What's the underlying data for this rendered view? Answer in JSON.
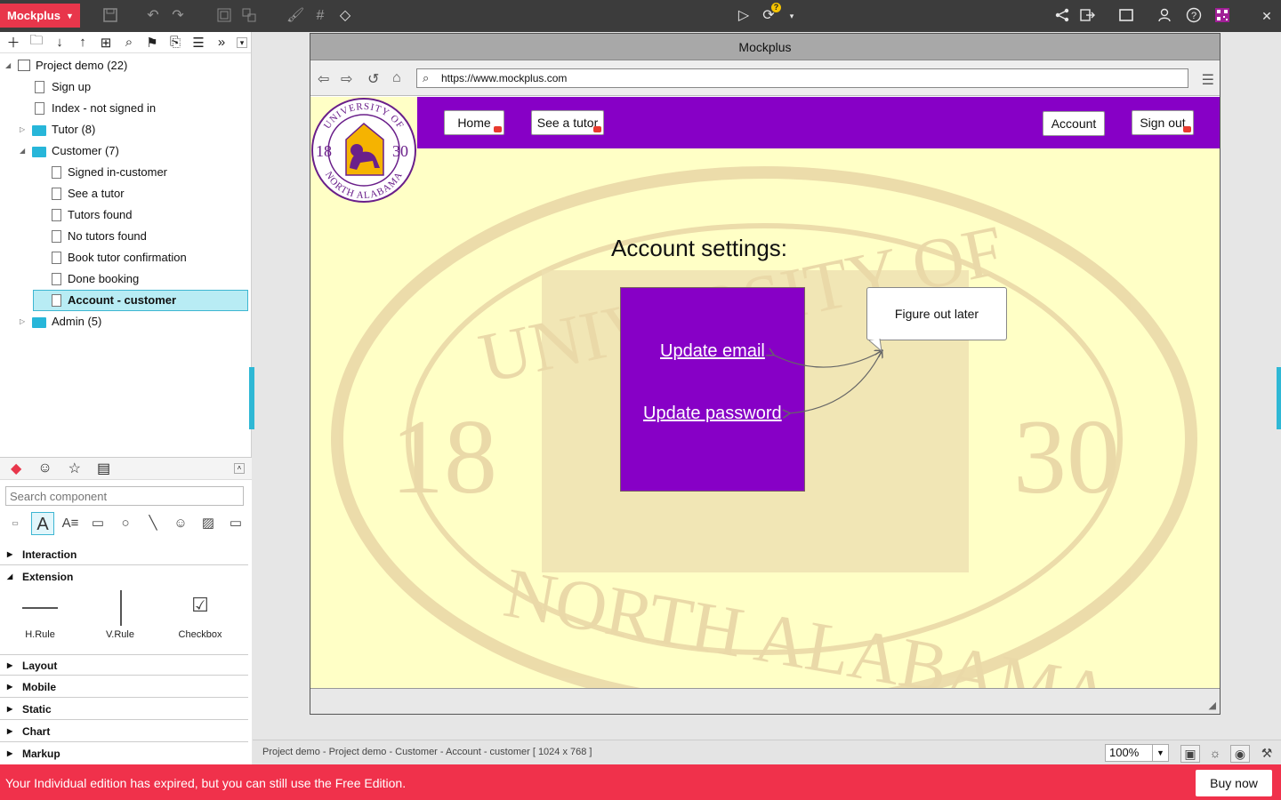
{
  "app": {
    "name": "Mockplus"
  },
  "toolbar": {
    "icons": [
      "save-icon",
      "undo-icon",
      "redo-icon",
      "group-icon",
      "ungroup-icon",
      "format-painter-icon",
      "grid-icon",
      "fill-icon",
      "play-icon",
      "sync-icon",
      "share-icon",
      "export-icon",
      "fullscreen-icon",
      "team-icon",
      "help-icon",
      "qr-code-icon",
      "close-icon"
    ],
    "sync_badge": "?"
  },
  "tree": {
    "items": [
      {
        "label": "Project demo (22)",
        "type": "project",
        "level": 0,
        "expanded": true
      },
      {
        "label": "Sign up",
        "type": "page",
        "level": 1
      },
      {
        "label": "Index - not signed in",
        "type": "page",
        "level": 1
      },
      {
        "label": "Tutor (8)",
        "type": "folder",
        "level": 1,
        "expanded": false
      },
      {
        "label": "Customer (7)",
        "type": "folder",
        "level": 1,
        "expanded": true
      },
      {
        "label": "Signed in-customer",
        "type": "page",
        "level": 2
      },
      {
        "label": "See a tutor",
        "type": "page",
        "level": 2
      },
      {
        "label": "Tutors found",
        "type": "page",
        "level": 2
      },
      {
        "label": "No tutors found",
        "type": "page",
        "level": 2
      },
      {
        "label": "Book tutor confirmation",
        "type": "page",
        "level": 2
      },
      {
        "label": "Done booking",
        "type": "page",
        "level": 2
      },
      {
        "label": "Account - customer",
        "type": "page",
        "level": 2,
        "selected": true
      },
      {
        "label": "Admin (5)",
        "type": "folder",
        "level": 1,
        "expanded": false
      }
    ]
  },
  "components": {
    "search_placeholder": "Search component",
    "categories": [
      {
        "label": "Interaction",
        "expanded": false
      },
      {
        "label": "Extension",
        "expanded": true
      },
      {
        "label": "Layout",
        "expanded": false
      },
      {
        "label": "Mobile",
        "expanded": false
      },
      {
        "label": "Static",
        "expanded": false
      },
      {
        "label": "Chart",
        "expanded": false
      },
      {
        "label": "Markup",
        "expanded": false
      }
    ],
    "extension_items": [
      "H.Rule",
      "V.Rule",
      "Checkbox"
    ]
  },
  "browser": {
    "title": "Mockplus",
    "url": "https://www.mockplus.com"
  },
  "page": {
    "logo": {
      "top_text": "UNIVERSITY OF",
      "bottom_text": "NORTH ALABAMA",
      "year_left": "18",
      "year_right": "30"
    },
    "nav": {
      "home": "Home",
      "see_tutor": "See a tutor",
      "account": "Account",
      "sign_out": "Sign out"
    },
    "heading": "Account settings:",
    "links": {
      "update_email": "Update email",
      "update_password": "Update password"
    },
    "note": "Figure out later",
    "colors": {
      "purple": "#8700c6",
      "page_bg": "#ffffc6",
      "logo_gold": "#f5b301"
    }
  },
  "status": {
    "path": "Project demo - Project demo - Customer - Account - customer [ 1024 x 768 ]",
    "zoom": "100%"
  },
  "banner": {
    "message": "Your Individual edition has expired, but you can still use the Free Edition.",
    "buy_label": "Buy now"
  }
}
